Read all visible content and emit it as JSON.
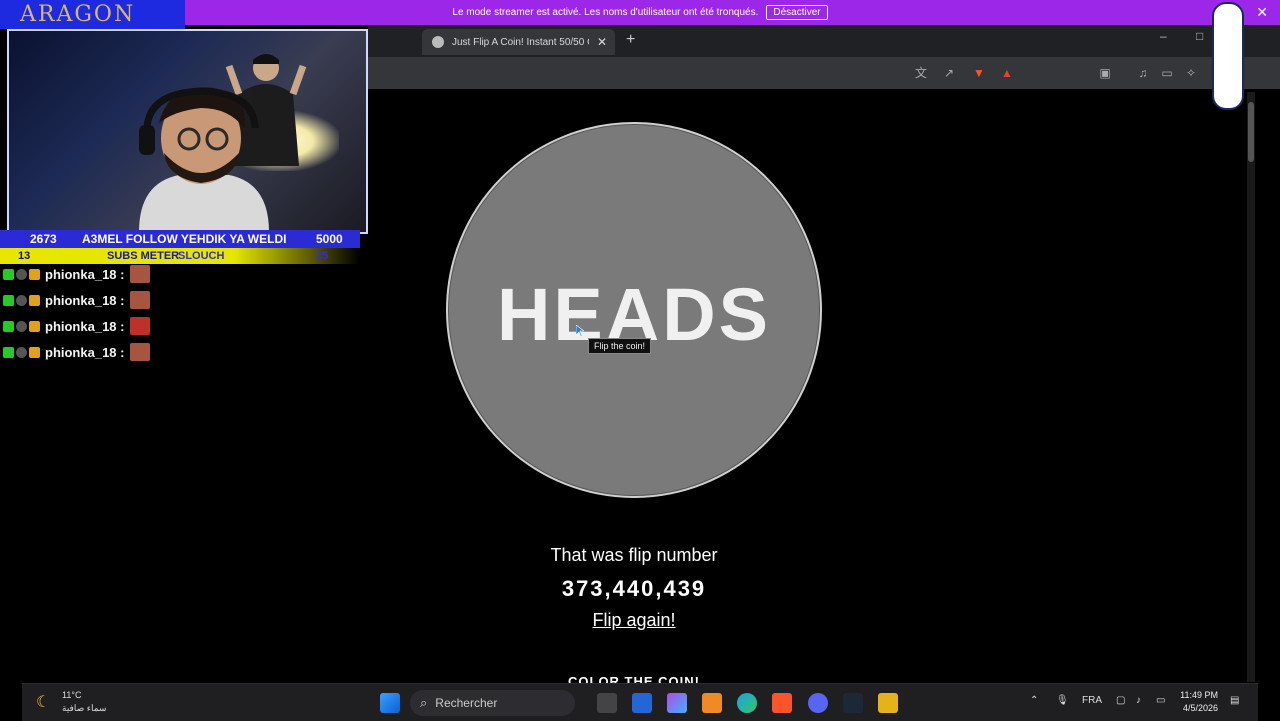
{
  "banner": {
    "message": "Le mode streamer est activé. Les noms d'utilisateur ont été tronqués.",
    "dismiss_label": "Désactiver"
  },
  "browser": {
    "tab_title": "Just Flip A Coin! Instant 50/50 C",
    "new_tab": "+",
    "minimize": "–",
    "maximize": "□",
    "close": "✕"
  },
  "overlay": {
    "logo_text": "ARAGON",
    "follow_count": "2673",
    "follow_text": "A3MEL FOLLOW YEHDIK YA WELDI",
    "follow_goal": "5000",
    "subs_count": "13",
    "subs_text": "SUBS METER",
    "subs_ghost": "SLOUCH",
    "subs_goal": "25"
  },
  "chat": {
    "messages": [
      {
        "user": "phionka_18 :"
      },
      {
        "user": "phionka_18 :"
      },
      {
        "user": "phionka_18 :"
      },
      {
        "user": "phionka_18 :"
      }
    ]
  },
  "page": {
    "coin_face": "HEADS",
    "tooltip": "Flip the coin!",
    "flip_label": "That was flip number",
    "flip_number": "373,440,439",
    "flip_again": "Flip again!",
    "color_heading": "COLOR THE COIN!"
  },
  "taskbar": {
    "search_placeholder": "Rechercher",
    "weather_temp": "11°C",
    "weather_desc": "سماء صافية",
    "language": "FRA",
    "time": "11:49 PM",
    "date": "4/5/2026"
  },
  "colors": {
    "banner": "#9c27e8",
    "coin": "#7a7a7a",
    "strip_blue": "#2b2bd6",
    "strip_yellow": "#e7e600"
  }
}
